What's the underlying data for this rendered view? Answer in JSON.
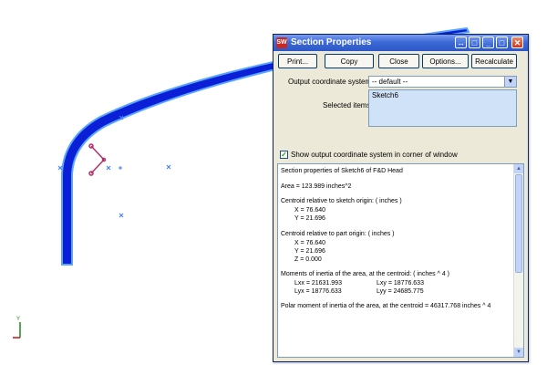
{
  "window": {
    "title": "Section Properties",
    "icon_label": "SW",
    "controls": [
      "pin-icon",
      "restore-icon",
      "minimize-icon",
      "maximize-icon",
      "close-icon"
    ]
  },
  "toolbar": {
    "print_label": "Print...",
    "copy_label": "Copy",
    "close_label": "Close",
    "options_label": "Options...",
    "recalculate_label": "Recalculate"
  },
  "form": {
    "coord_label": "Output coordinate system:",
    "coord_value": "-- default --",
    "selected_label": "Selected items:",
    "selected_items": [
      "Sketch6"
    ],
    "show_coord_label": "Show output coordinate system in corner of window",
    "show_coord_checked": true
  },
  "results": {
    "lines": [
      "Section properties of Sketch6 of F&D Head",
      "Area = 123.989 inches^2",
      "Centroid relative to sketch origin: ( inches )",
      "X = 76.640",
      "Y = 21.696",
      "Centroid relative to part origin: ( inches )",
      "X = 76.640",
      "Y = 21.696",
      "Z = 0.000",
      "Moments of inertia of the area, at the centroid: ( inches ^ 4 )",
      "Lxx = 21631.993",
      "Lxy = 18776.633",
      "Lyx = 18776.633",
      "Lyy = 24685.775",
      "Polar moment of inertia of the area, at the centroid = 46317.768 inches ^ 4"
    ]
  },
  "axis_triad": {
    "y_label": "Y",
    "x_label": "X"
  },
  "colors": {
    "profile_fill": "#0a1fd6",
    "profile_edge": "#5aa5ff",
    "title_blue": "#2c57c8",
    "point_marker": "#b0306a"
  }
}
